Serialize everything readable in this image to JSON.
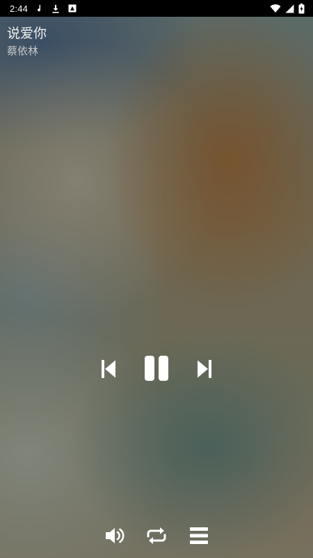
{
  "status_bar": {
    "time": "2:44",
    "icons": [
      "music-note-icon",
      "download-icon",
      "image-notification-icon",
      "wifi-icon",
      "cell-signal-icon",
      "battery-charging-icon"
    ]
  },
  "track": {
    "title": "说爱你",
    "artist": "蔡依林"
  },
  "controls": {
    "previous_icon": "skip-previous-icon",
    "play_state_icon": "pause-icon",
    "next_icon": "skip-next-icon"
  },
  "bottom_bar": {
    "volume_icon": "volume-icon",
    "repeat_icon": "repeat-icon",
    "playlist_icon": "playlist-icon"
  },
  "colors": {
    "status_bar_bg": "#000000",
    "icon_color": "#ffffff",
    "title_color": "#f2f2f2",
    "artist_color": "#c9c9c9"
  }
}
